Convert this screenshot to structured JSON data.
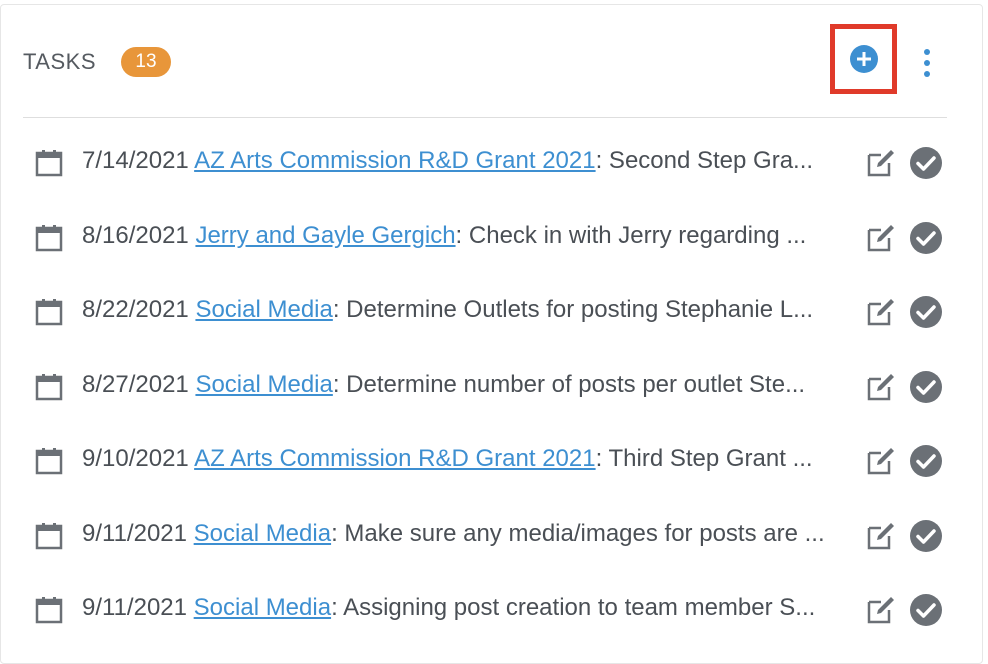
{
  "header": {
    "title": "TASKS",
    "count": "13",
    "add_icon": "plus-circle-icon",
    "menu_icon": "kebab-menu-icon"
  },
  "colors": {
    "accent": "#3d8fd1",
    "badge": "#e8963a",
    "highlight": "#e03a2a",
    "icon": "#6b7076"
  },
  "tasks": [
    {
      "date": "7/14/2021",
      "link": "AZ Arts Commission R&D Grant 2021",
      "desc": ": Second Step Gra..."
    },
    {
      "date": "8/16/2021",
      "link": "Jerry and Gayle Gergich",
      "desc": ": Check in with Jerry regarding ..."
    },
    {
      "date": "8/22/2021",
      "link": "Social Media",
      "desc": ": Determine Outlets for posting Stephanie L..."
    },
    {
      "date": "8/27/2021",
      "link": "Social Media",
      "desc": ": Determine number of posts per outlet Ste..."
    },
    {
      "date": "9/10/2021",
      "link": "AZ Arts Commission R&D Grant 2021",
      "desc": ": Third Step Grant ..."
    },
    {
      "date": "9/11/2021",
      "link": "Social Media",
      "desc": ": Make sure any media/images for posts are ..."
    },
    {
      "date": "9/11/2021",
      "link": "Social Media",
      "desc": ": Assigning post creation to team member S..."
    }
  ]
}
